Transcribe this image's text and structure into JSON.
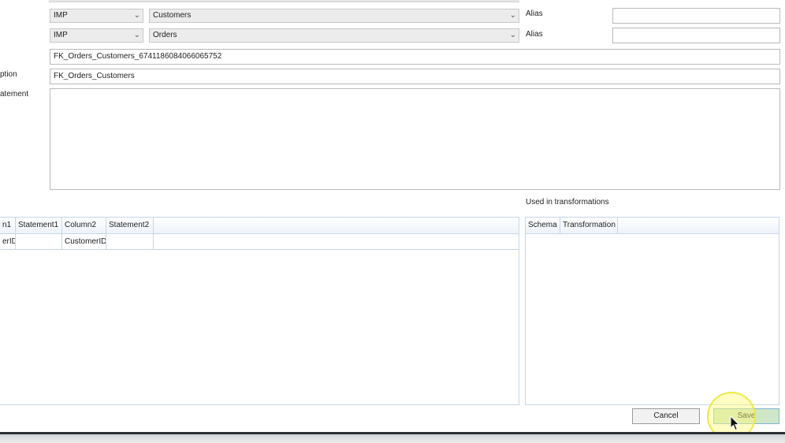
{
  "relation": {
    "parent_schema": "IMP",
    "parent_table": "Customers",
    "parent_alias_label": "Alias",
    "parent_alias_value": "",
    "child_schema": "IMP",
    "child_table": "Orders",
    "child_alias_label": "Alias",
    "child_alias_value": "",
    "name_value": "FK_Orders_Customers_6741186084066065752",
    "caption_label": "ption",
    "caption_value": "FK_Orders_Customers",
    "statement_label": "atement"
  },
  "columns_grid": {
    "headers": [
      "n1",
      "Statement1",
      "Column2",
      "Statement2"
    ],
    "rows": [
      [
        "erID",
        "",
        "CustomerID",
        ""
      ]
    ]
  },
  "transformations": {
    "title": "Used in transformations",
    "headers": [
      "Schema",
      "Transformation"
    ]
  },
  "buttons": {
    "cancel_label": "Cancel",
    "save_label": "Save"
  },
  "icons": {
    "dropdown": "chevron-down-icon",
    "cursor": "mouse-pointer-icon"
  }
}
